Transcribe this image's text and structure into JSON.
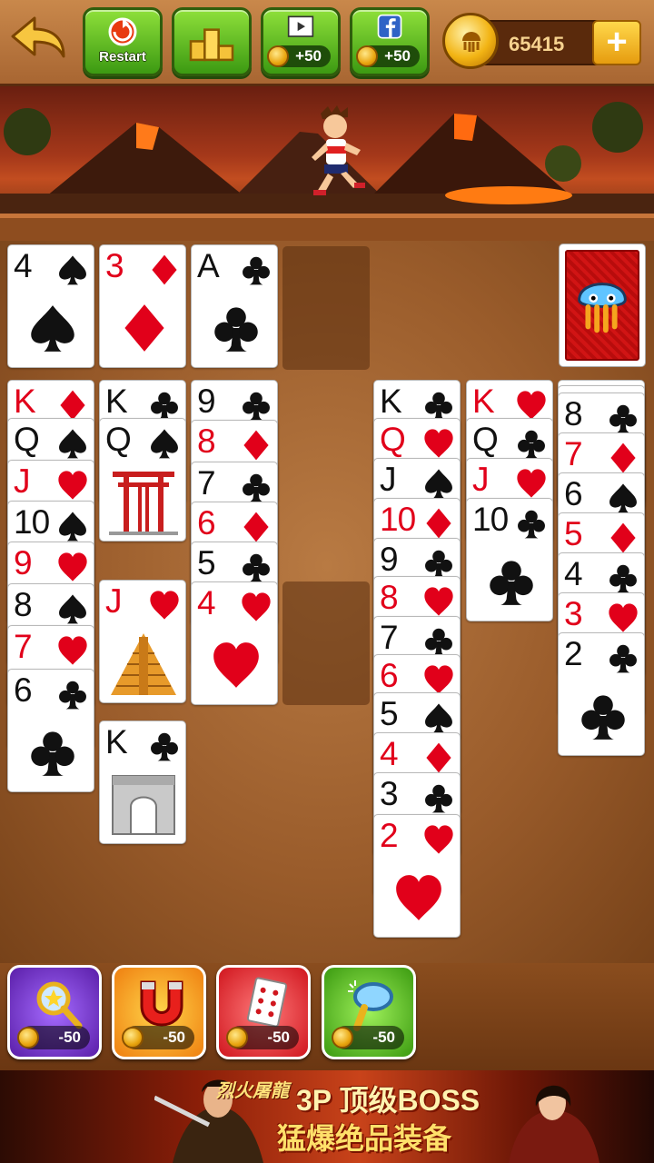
{
  "toolbar": {
    "restart_label": "Restart",
    "video_reward": "+50",
    "facebook_reward": "+50",
    "coins": "65415",
    "plus_label": "+"
  },
  "colors": {
    "felt": "#9a5c2b",
    "red_suit": "#e1001a",
    "black_suit": "#111111",
    "green_button": "#4caf1a"
  },
  "foundations": [
    {
      "rank": "4",
      "suit": "spades"
    },
    {
      "rank": "3",
      "suit": "diamonds"
    },
    {
      "rank": "A",
      "suit": "clubs"
    }
  ],
  "tableau": [
    [
      {
        "rank": "K",
        "suit": "diamonds"
      },
      {
        "rank": "Q",
        "suit": "spades"
      },
      {
        "rank": "J",
        "suit": "hearts"
      },
      {
        "rank": "10",
        "suit": "spades"
      },
      {
        "rank": "9",
        "suit": "hearts"
      },
      {
        "rank": "8",
        "suit": "spades"
      },
      {
        "rank": "7",
        "suit": "hearts"
      },
      {
        "rank": "6",
        "suit": "clubs"
      }
    ],
    [
      {
        "rank": "K",
        "suit": "clubs"
      },
      {
        "rank": "Q",
        "suit": "spades",
        "picture": "torii-gate"
      },
      {
        "rank": "J",
        "suit": "hearts",
        "picture": "pyramid"
      },
      {
        "rank": "K",
        "suit": "clubs",
        "picture": "arc-de-triomphe"
      }
    ],
    [
      {
        "rank": "9",
        "suit": "clubs"
      },
      {
        "rank": "8",
        "suit": "diamonds"
      },
      {
        "rank": "7",
        "suit": "clubs"
      },
      {
        "rank": "6",
        "suit": "diamonds"
      },
      {
        "rank": "5",
        "suit": "clubs"
      },
      {
        "rank": "4",
        "suit": "hearts"
      }
    ],
    [],
    [
      {
        "rank": "K",
        "suit": "clubs"
      },
      {
        "rank": "Q",
        "suit": "hearts"
      },
      {
        "rank": "J",
        "suit": "spades"
      },
      {
        "rank": "10",
        "suit": "diamonds"
      },
      {
        "rank": "9",
        "suit": "clubs"
      },
      {
        "rank": "8",
        "suit": "hearts"
      },
      {
        "rank": "7",
        "suit": "clubs"
      },
      {
        "rank": "6",
        "suit": "hearts"
      },
      {
        "rank": "5",
        "suit": "spades"
      },
      {
        "rank": "4",
        "suit": "diamonds"
      },
      {
        "rank": "3",
        "suit": "clubs"
      },
      {
        "rank": "2",
        "suit": "hearts"
      }
    ],
    [
      {
        "rank": "K",
        "suit": "hearts"
      },
      {
        "rank": "Q",
        "suit": "clubs"
      },
      {
        "rank": "J",
        "suit": "hearts"
      },
      {
        "rank": "10",
        "suit": "clubs"
      }
    ],
    [
      {
        "rank": "8",
        "suit": "clubs"
      },
      {
        "rank": "7",
        "suit": "diamonds"
      },
      {
        "rank": "6",
        "suit": "spades"
      },
      {
        "rank": "5",
        "suit": "diamonds"
      },
      {
        "rank": "4",
        "suit": "clubs"
      },
      {
        "rank": "3",
        "suit": "hearts"
      },
      {
        "rank": "2",
        "suit": "clubs"
      }
    ]
  ],
  "powerups": [
    {
      "name": "magic-wand",
      "cost": "-50"
    },
    {
      "name": "magnet",
      "cost": "-50"
    },
    {
      "name": "card",
      "cost": "-50"
    },
    {
      "name": "magnifier",
      "cost": "-50"
    }
  ],
  "ad": {
    "brand": "烈火屠龍",
    "line1": "3P 顶级BOSS",
    "line2": "猛爆绝品装备"
  }
}
